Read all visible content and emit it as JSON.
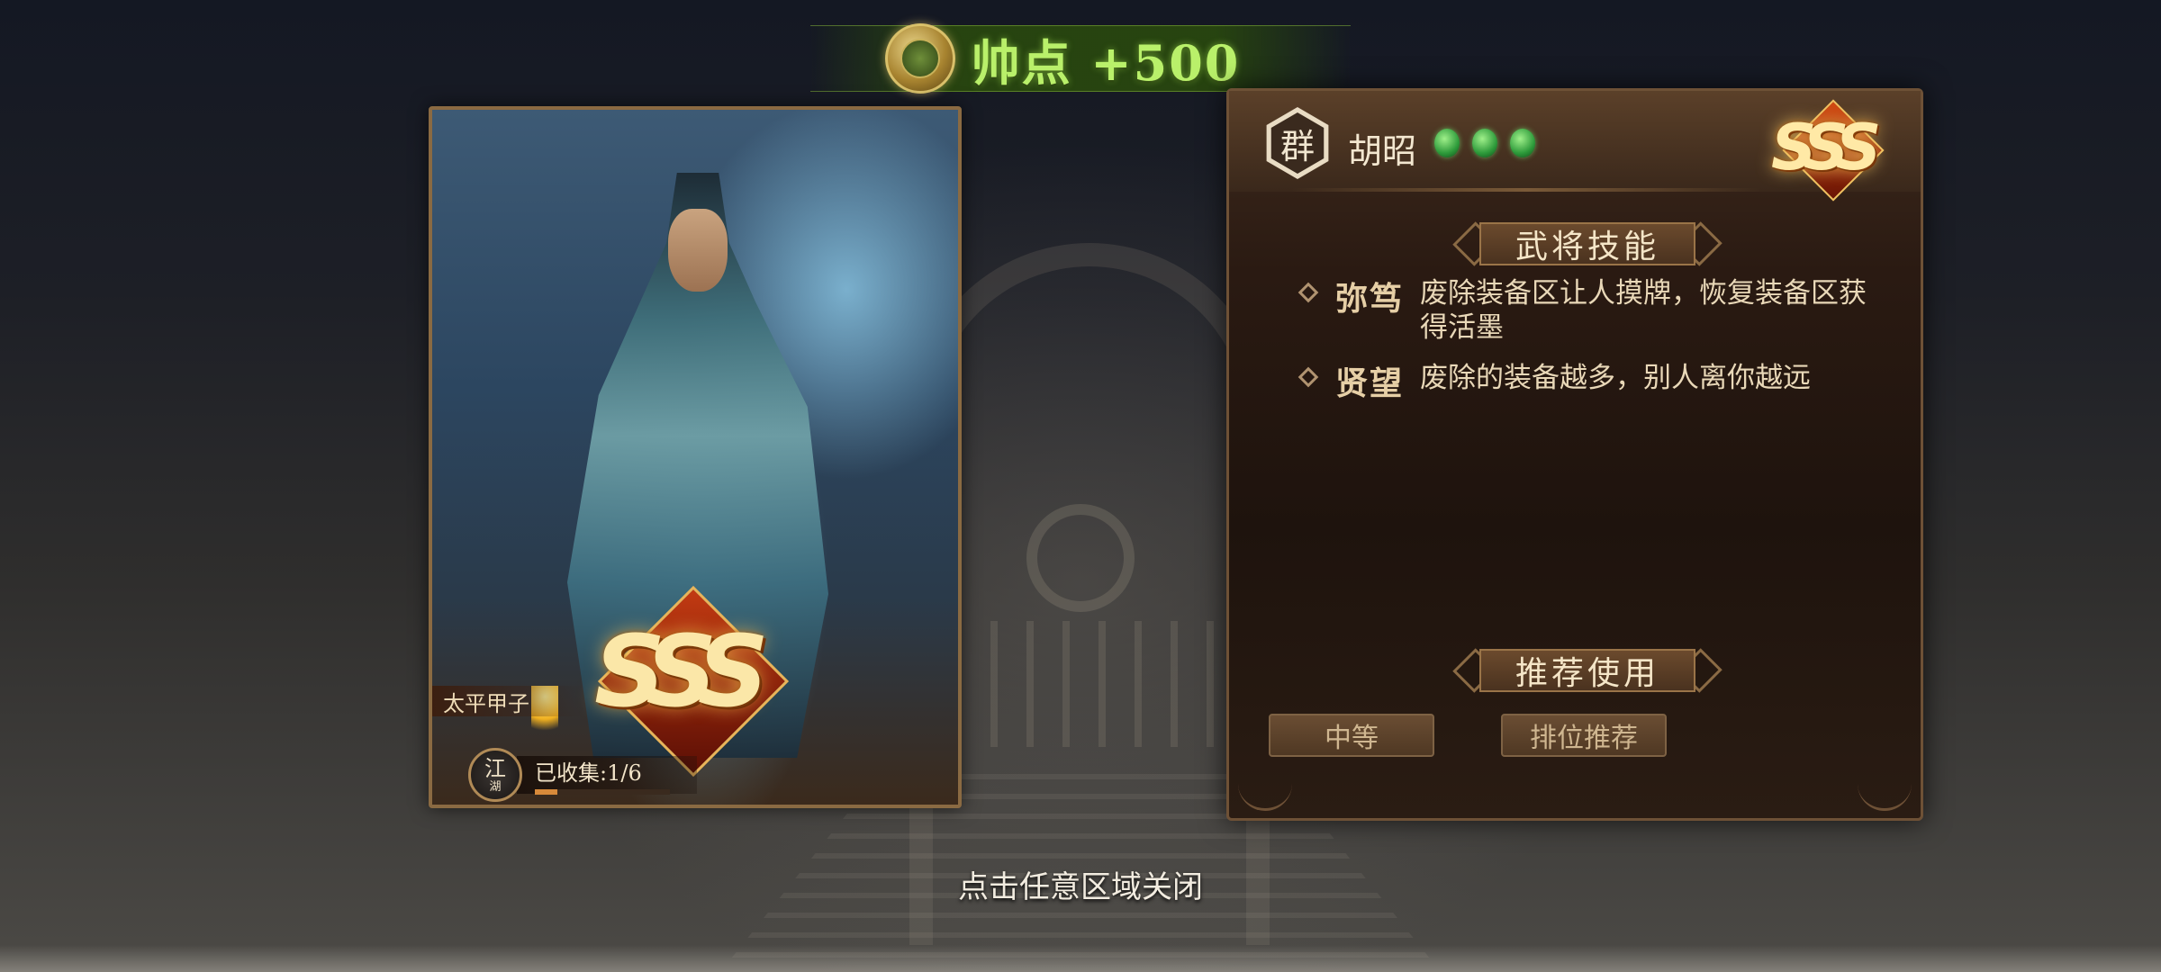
{
  "reward": {
    "text": "帅点 +500",
    "icon": "gold-coin-icon"
  },
  "hero_card": {
    "pack_tag": "太平甲子",
    "collection_badge_main": "江",
    "collection_badge_sub": "湖",
    "collected_text": "已收集:1/6",
    "collected_progress": 0.1667,
    "rating": "SSS"
  },
  "info_panel": {
    "faction_glyph": "群",
    "hero_name": "胡昭",
    "gem_count": 3,
    "rating": "SSS",
    "skills_title": "武将技能",
    "skills": [
      {
        "name": "弥笃",
        "desc": "废除装备区让人摸牌，恢复装备区获得活墨"
      },
      {
        "name": "贤望",
        "desc": "废除的装备越多，别人离你越远"
      }
    ],
    "recommend_title": "推荐使用",
    "recommend_tags": [
      "中等",
      "排位推荐"
    ]
  },
  "close_hint": "点击任意区域关闭",
  "colors": {
    "gem": "#2d9a3a",
    "reward_text": "#b9f06a",
    "panel_bg": "#1e130d"
  }
}
